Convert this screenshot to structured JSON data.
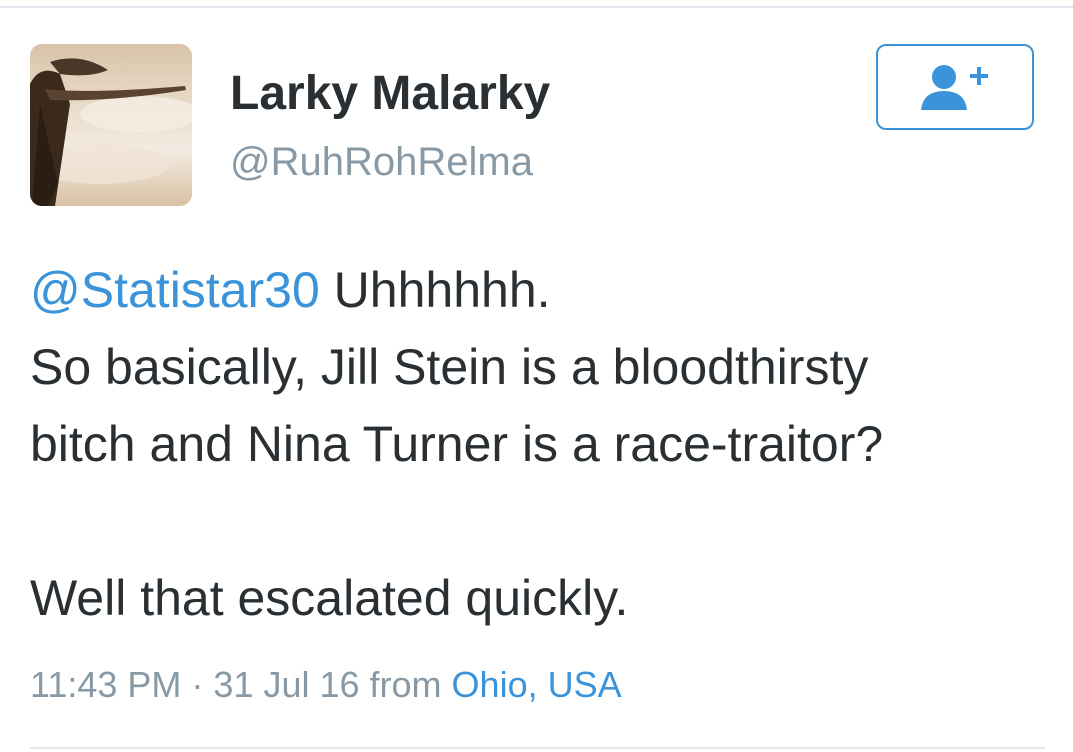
{
  "profile": {
    "display_name": "Larky Malarky",
    "handle": "@RuhRohRelma",
    "avatar": "profile-photo"
  },
  "follow_button": {
    "icon": "add-user-icon",
    "color": "#3b94d9"
  },
  "tweet": {
    "mention": "@Statistar30",
    "line1_rest": " Uhhhhhh.",
    "line2": "So basically, Jill Stein is a bloodthirsty",
    "line3": "bitch and Nina Turner is a race-traitor?",
    "line4": "Well that escalated quickly."
  },
  "meta": {
    "time": "11:43 PM",
    "separator": " · ",
    "date": "31 Jul 16",
    "from_label": " from ",
    "location": "Ohio, USA"
  },
  "colors": {
    "text": "#292f33",
    "muted": "#8899a6",
    "link": "#3b94d9",
    "divider": "#e1e8ed"
  }
}
